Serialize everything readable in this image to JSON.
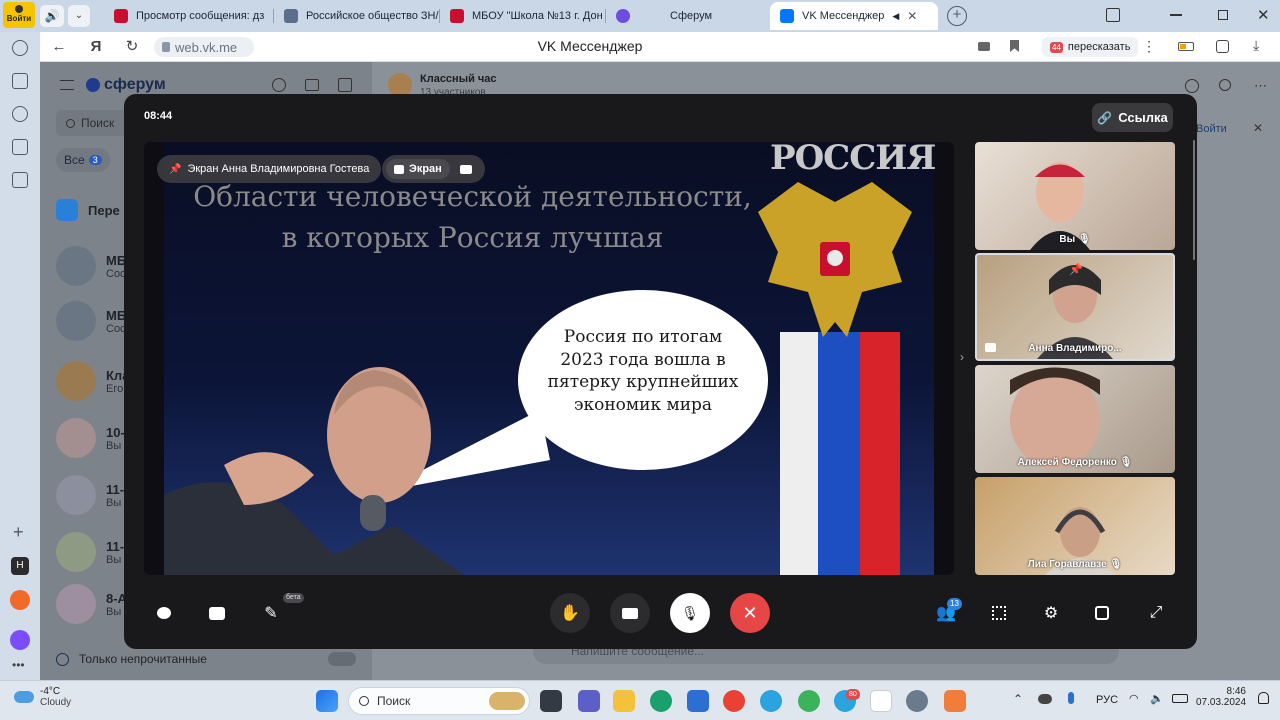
{
  "browser": {
    "login_label": "Войти",
    "tabs": [
      {
        "title": "Просмотр сообщения: дз",
        "color": "#c8102e"
      },
      {
        "title": "Российское общество ЗН/",
        "color": "#5a6f8c"
      },
      {
        "title": "МБОУ \"Школа №13 г. Дон",
        "color": "#c8102e"
      },
      {
        "title": "Сферум",
        "color": "#6e4ce0"
      },
      {
        "title": "VK Мессенджер",
        "color": "#0077ff"
      }
    ],
    "url": "web.vk.me",
    "page_title": "VK Мессенджер",
    "retell_label": "пересказать",
    "retell_badge": "44"
  },
  "sidebar": {
    "brand": "сферум",
    "search_placeholder": "Поиск",
    "filter_all": "Все",
    "filter_all_count": "3",
    "pinned_label": "Пере",
    "items": [
      {
        "title": "МБ",
        "sub": "Соо"
      },
      {
        "title": "МБ",
        "sub": "Соо"
      },
      {
        "title": "Кла",
        "sub": "Его"
      },
      {
        "title": "10-",
        "sub": "Вы"
      },
      {
        "title": "11-",
        "sub": "Вы"
      },
      {
        "title": "11-",
        "sub": "Вы"
      },
      {
        "title": "8-А",
        "sub": "Вы"
      }
    ],
    "unread_only_label": "Только непрочитанные"
  },
  "chat_header": {
    "title": "Классный час",
    "members": "13 участников",
    "login_hint": "Войти"
  },
  "composer_placeholder": "Напишите сообщение...",
  "call": {
    "timer": "08:44",
    "link_label": "Ссылка",
    "pin_chip": "Экран Анна Владимировна Гостева",
    "screen_chip": "Экран",
    "slide": {
      "title": "Области человеческой деятельности, в которых Россия лучшая",
      "bubble": "Россия по итогам 2023 года вошла в пятерку крупнейших экономик мира",
      "banner_text": "РОССИЯ"
    },
    "participants": [
      {
        "name": "Вы",
        "muted": true
      },
      {
        "name": "Анна Владимиро...",
        "muted": false
      },
      {
        "name": "Алексей Федоренко",
        "muted": true
      },
      {
        "name": "Лиа Горавлавзе",
        "muted": true
      }
    ],
    "controls": {
      "beta_badge": "бета",
      "participants_count": "13"
    }
  },
  "taskbar": {
    "weather_temp": "-4°C",
    "weather_desc": "Cloudy",
    "search_label": "Поиск",
    "lang": "РУС",
    "time": "8:46",
    "date": "07.03.2024",
    "mail_badge": "80"
  },
  "colors": {
    "accent_blue": "#0077ff",
    "end_call_red": "#e64646",
    "modal_bg": "#19191b"
  }
}
